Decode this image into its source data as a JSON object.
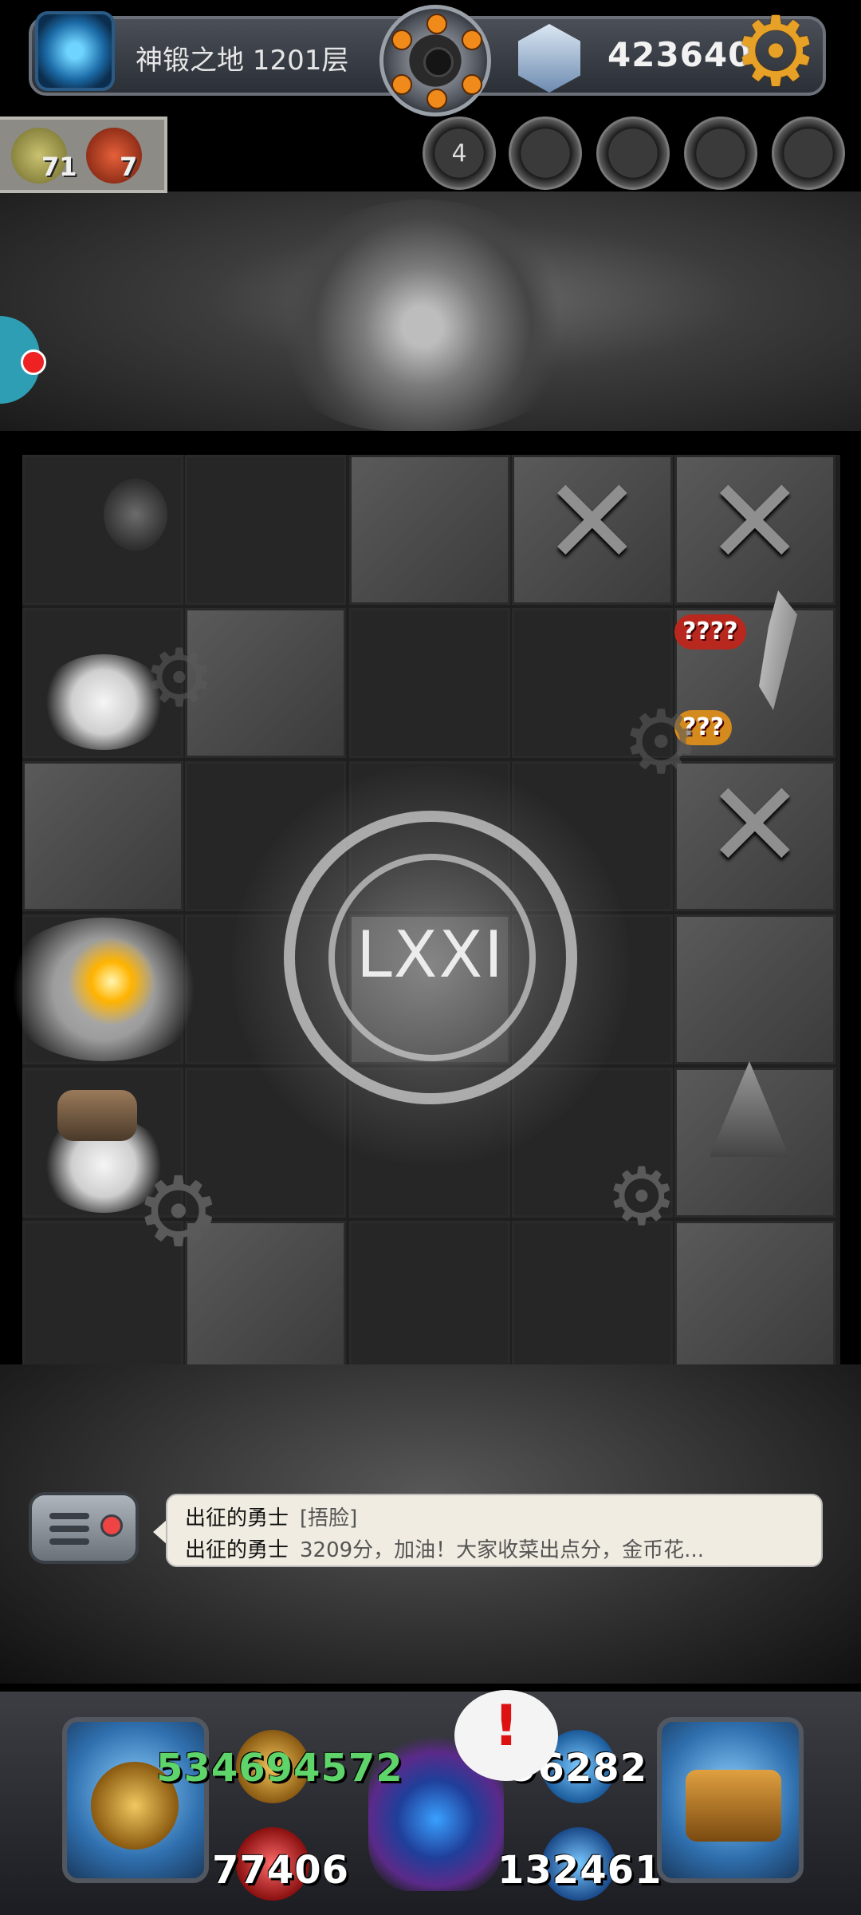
{
  "header": {
    "floor_title": "神锻之地 1201层",
    "gold": "423640",
    "icons": [
      "portal-icon",
      "bomb-icon",
      "gem-icon",
      "gear-icon"
    ]
  },
  "resources": [
    {
      "icon": "green-seal-icon",
      "count": "71"
    },
    {
      "icon": "red-claw-icon",
      "count": "7"
    }
  ],
  "abilities": [
    {
      "name": "ability-lightning",
      "label": "4"
    },
    {
      "name": "ability-monster-1",
      "label": ""
    },
    {
      "name": "ability-monster-2",
      "label": ""
    },
    {
      "name": "ability-monster-3",
      "label": ""
    },
    {
      "name": "ability-monster-4",
      "label": ""
    }
  ],
  "board": {
    "level_roman": "LXXI",
    "mystery_labels": [
      "????",
      "???"
    ]
  },
  "chat": {
    "lines": [
      {
        "name": "出征的勇士",
        "text": "[捂脸]"
      },
      {
        "name": "出征的勇士",
        "text": "3209分，加油！大家收菜出点分，金币花..."
      }
    ]
  },
  "stats": {
    "attack": "534694572",
    "defense": "96282",
    "hp": "77406",
    "mana": "132461",
    "attack_color": "#5fd46a",
    "default_color": "#ffffff"
  },
  "alert": {
    "symbol": "!"
  }
}
